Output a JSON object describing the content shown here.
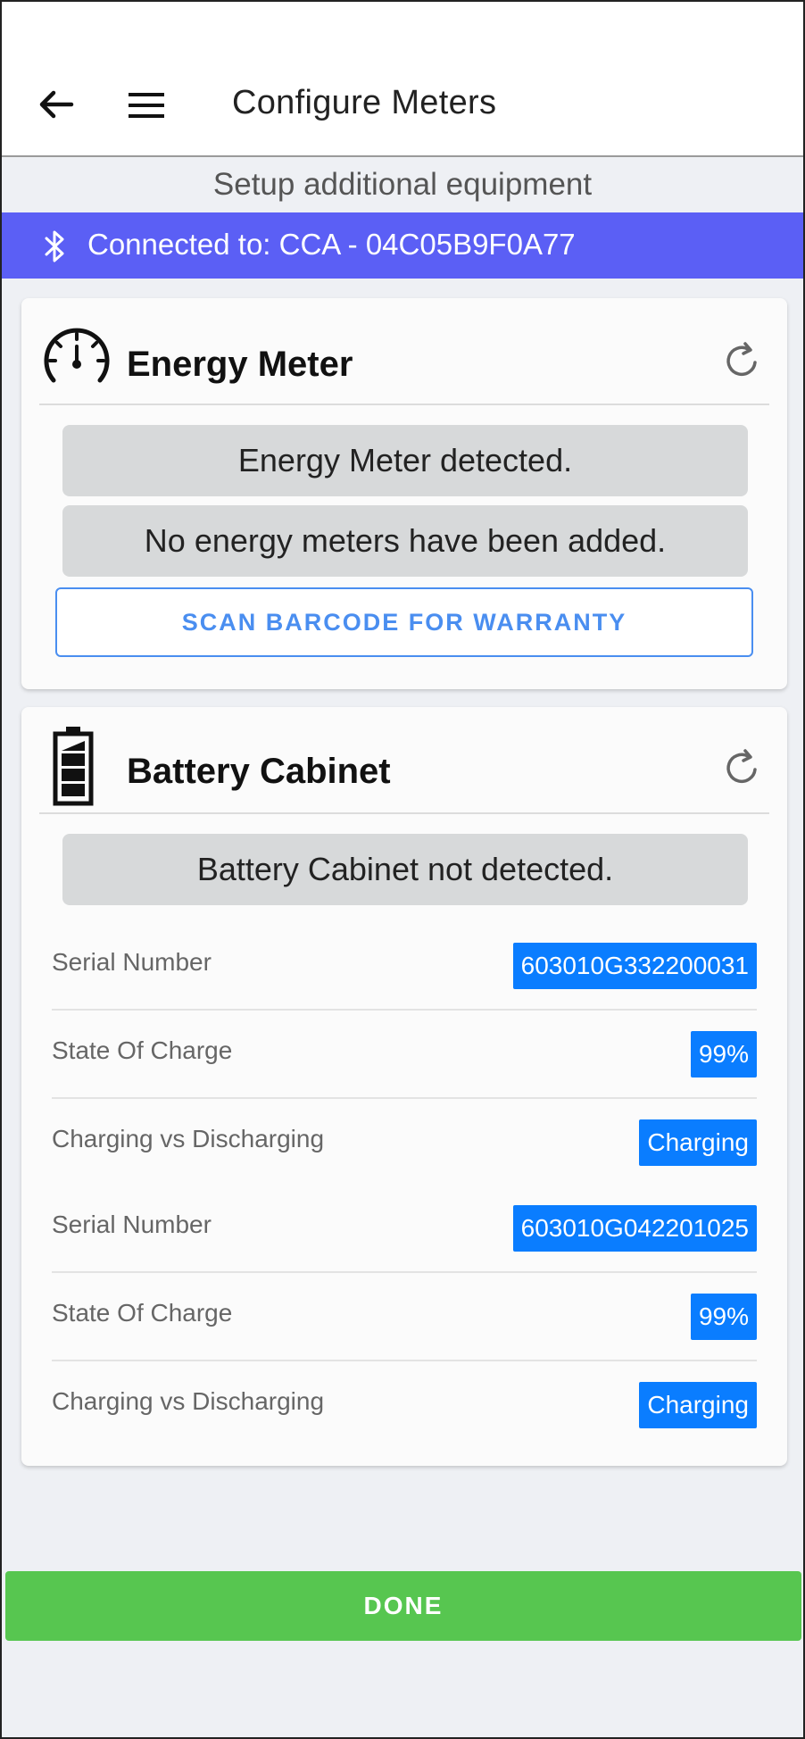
{
  "header": {
    "title": "Configure Meters",
    "subtitle": "Setup additional equipment"
  },
  "connection": {
    "text": "Connected to: CCA - 04C05B9F0A77"
  },
  "energy_meter": {
    "title": "Energy Meter",
    "status_detected": "Energy Meter detected.",
    "status_added": "No energy meters have been added.",
    "scan_button": "SCAN BARCODE FOR WARRANTY"
  },
  "battery_cabinet": {
    "title": "Battery Cabinet",
    "status": "Battery Cabinet not detected.",
    "rows": [
      {
        "label": "Serial Number",
        "value": "603010G332200031"
      },
      {
        "label": "State Of Charge",
        "value": "99%"
      },
      {
        "label": "Charging vs Discharging",
        "value": "Charging"
      },
      {
        "label": "Serial Number",
        "value": "603010G042201025"
      },
      {
        "label": "State Of Charge",
        "value": "99%"
      },
      {
        "label": "Charging vs Discharging",
        "value": "Charging"
      }
    ]
  },
  "footer": {
    "done_button": "DONE"
  },
  "colors": {
    "connection_bar": "#5b5ff5",
    "value_badge": "#0a7dff",
    "done_button": "#57c650",
    "scan_button_border": "#4a8ef0"
  }
}
